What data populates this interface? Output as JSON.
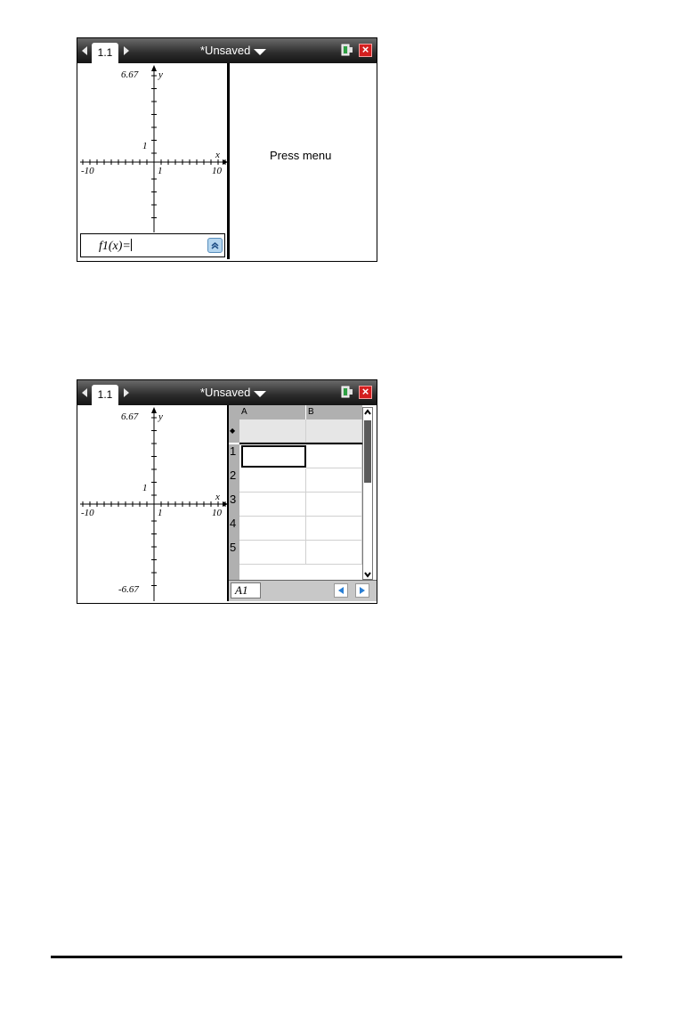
{
  "screen1": {
    "tab_label": "1.1",
    "doc_title": "*Unsaved",
    "graph": {
      "y_max_label": "6.67",
      "y_axis_label": "y",
      "x_axis_label": "x",
      "tick_one_y": "1",
      "x_min_label": "-10",
      "x_one_label": "1",
      "x_max_label": "10"
    },
    "entry_line": "f1(x)=",
    "right_panel_text": "Press menu"
  },
  "screen2": {
    "tab_label": "1.1",
    "doc_title": "*Unsaved",
    "graph": {
      "y_max_label": "6.67",
      "y_min_label": "-6.67",
      "y_axis_label": "y",
      "x_axis_label": "x",
      "tick_one_y": "1",
      "x_min_label": "-10",
      "x_one_label": "1",
      "x_max_label": "10"
    },
    "spreadsheet": {
      "columns": [
        "A",
        "B"
      ],
      "formula_row_marker": "◆",
      "rows": [
        "1",
        "2",
        "3",
        "4",
        "5"
      ],
      "selected_cell": "A1"
    }
  },
  "colors": {
    "titlebar": "#2b2b2b",
    "close_button": "#d41f1f",
    "header_gray": "#b0b0b0",
    "nav_arrow": "#2a7fd4"
  }
}
